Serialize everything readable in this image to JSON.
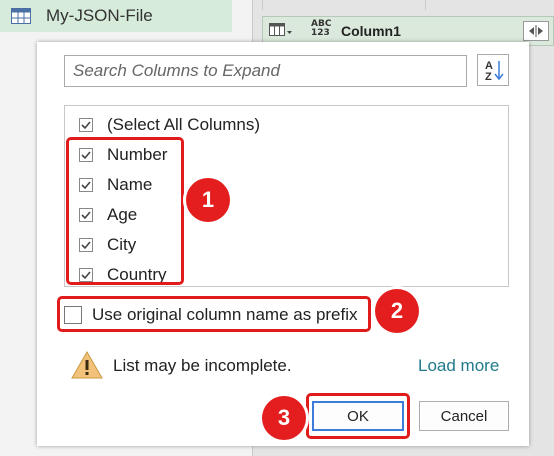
{
  "query_pane": {
    "item_label": "My-JSON-File",
    "icon": "table-icon"
  },
  "column_header": {
    "type_label_top": "ABC",
    "type_label_bottom": "123",
    "name": "Column1",
    "type_icon": "table-type-icon",
    "expand_icon": "expand-columns-icon"
  },
  "dialog": {
    "search_placeholder": "Search Columns to Expand",
    "sort_icon": "sort-az-icon",
    "select_all": {
      "label": "(Select All Columns)",
      "checked": true
    },
    "columns": [
      {
        "label": "Number",
        "checked": true
      },
      {
        "label": "Name",
        "checked": true
      },
      {
        "label": "Age",
        "checked": true
      },
      {
        "label": "City",
        "checked": true
      },
      {
        "label": "Country",
        "checked": true
      }
    ],
    "prefix_option": {
      "label": "Use original column name as prefix",
      "checked": false
    },
    "warning": {
      "icon": "warning-icon",
      "text": "List may be incomplete."
    },
    "load_more": "Load more",
    "ok_label": "OK",
    "cancel_label": "Cancel"
  },
  "annotations": {
    "badge1": "1",
    "badge2": "2",
    "badge3": "3",
    "color": "#e01b1b"
  },
  "colors": {
    "accent_link": "#217a8c",
    "header_bg": "#dbe9dc",
    "focus_border": "#3b7dd8"
  }
}
